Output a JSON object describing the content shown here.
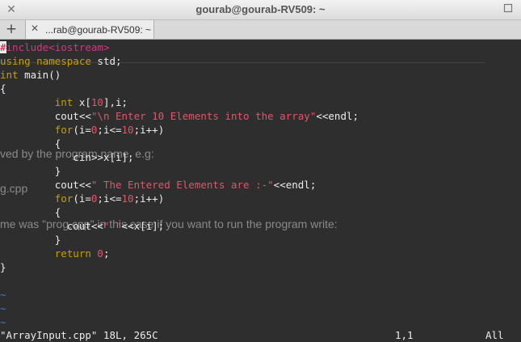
{
  "window": {
    "title": "gourab@gourab-RV509: ~",
    "menu_icon": "maximize-icon",
    "close_icon": "close-icon"
  },
  "tabs": {
    "new_tab": "+",
    "items": [
      {
        "label": "...rab@gourab-RV509: ~",
        "close": "✕"
      }
    ]
  },
  "editor": {
    "lines": [
      [
        {
          "t": "#",
          "c": "cur"
        },
        {
          "t": "include<iostream>",
          "c": "pp"
        }
      ],
      [
        {
          "t": "using namespace",
          "c": "kw"
        },
        {
          "t": " std;",
          "c": ""
        }
      ],
      [
        {
          "t": "int",
          "c": "kw"
        },
        {
          "t": " main()",
          "c": ""
        }
      ],
      [
        {
          "t": "{",
          "c": ""
        }
      ],
      [
        {
          "t": "         ",
          "c": ""
        },
        {
          "t": "int",
          "c": "kw"
        },
        {
          "t": " x[",
          "c": ""
        },
        {
          "t": "10",
          "c": "num"
        },
        {
          "t": "],i;",
          "c": ""
        }
      ],
      [
        {
          "t": "         cout<<",
          "c": ""
        },
        {
          "t": "\"\\n Enter 10 Elements into the array\"",
          "c": "str"
        },
        {
          "t": "<<endl;",
          "c": ""
        }
      ],
      [
        {
          "t": "         ",
          "c": ""
        },
        {
          "t": "for",
          "c": "kw"
        },
        {
          "t": "(i=",
          "c": ""
        },
        {
          "t": "0",
          "c": "num"
        },
        {
          "t": ";i<=",
          "c": ""
        },
        {
          "t": "10",
          "c": "num"
        },
        {
          "t": ";i++)",
          "c": ""
        }
      ],
      [
        {
          "t": "         {",
          "c": ""
        }
      ],
      [
        {
          "t": "            cin>>x[i];",
          "c": ""
        }
      ],
      [
        {
          "t": "         }",
          "c": ""
        }
      ],
      [
        {
          "t": "         cout<<",
          "c": ""
        },
        {
          "t": "\" The Entered Elements are :-\"",
          "c": "str"
        },
        {
          "t": "<<endl;",
          "c": ""
        }
      ],
      [
        {
          "t": "         ",
          "c": ""
        },
        {
          "t": "for",
          "c": "kw"
        },
        {
          "t": "(i=",
          "c": ""
        },
        {
          "t": "0",
          "c": "num"
        },
        {
          "t": ";i<=",
          "c": ""
        },
        {
          "t": "10",
          "c": "num"
        },
        {
          "t": ";i++)",
          "c": ""
        }
      ],
      [
        {
          "t": "         {",
          "c": ""
        }
      ],
      [
        {
          "t": "           cout<<",
          "c": ""
        },
        {
          "t": "\" \"",
          "c": "str"
        },
        {
          "t": "<<x[i];",
          "c": ""
        }
      ],
      [
        {
          "t": "         }",
          "c": ""
        }
      ],
      [
        {
          "t": "         ",
          "c": ""
        },
        {
          "t": "return",
          "c": "kw"
        },
        {
          "t": " ",
          "c": ""
        },
        {
          "t": "0",
          "c": "num"
        },
        {
          "t": ";",
          "c": ""
        }
      ],
      [
        {
          "t": "}",
          "c": ""
        }
      ],
      [
        {
          "t": "",
          "c": ""
        }
      ],
      [
        {
          "t": "~",
          "c": "tilde"
        }
      ],
      [
        {
          "t": "~",
          "c": "tilde"
        }
      ],
      [
        {
          "t": "~",
          "c": "tilde"
        }
      ]
    ]
  },
  "background_text": [
    "ved by the program name, e.g:",
    "g.cpp",
    "me was \"prog.cpp\" in this case if you want to run the program write:"
  ],
  "statusline": {
    "file": "\"ArrayInput.cpp\" 18L, 265C",
    "position": "1,1",
    "scroll": "All"
  },
  "colors": {
    "terminal_bg": "#2e2e2e",
    "text": "#ececec",
    "keyword": "#c4a000",
    "string": "#e0556a",
    "preprocessor": "#d33682",
    "tilde": "#3a7fc0"
  }
}
